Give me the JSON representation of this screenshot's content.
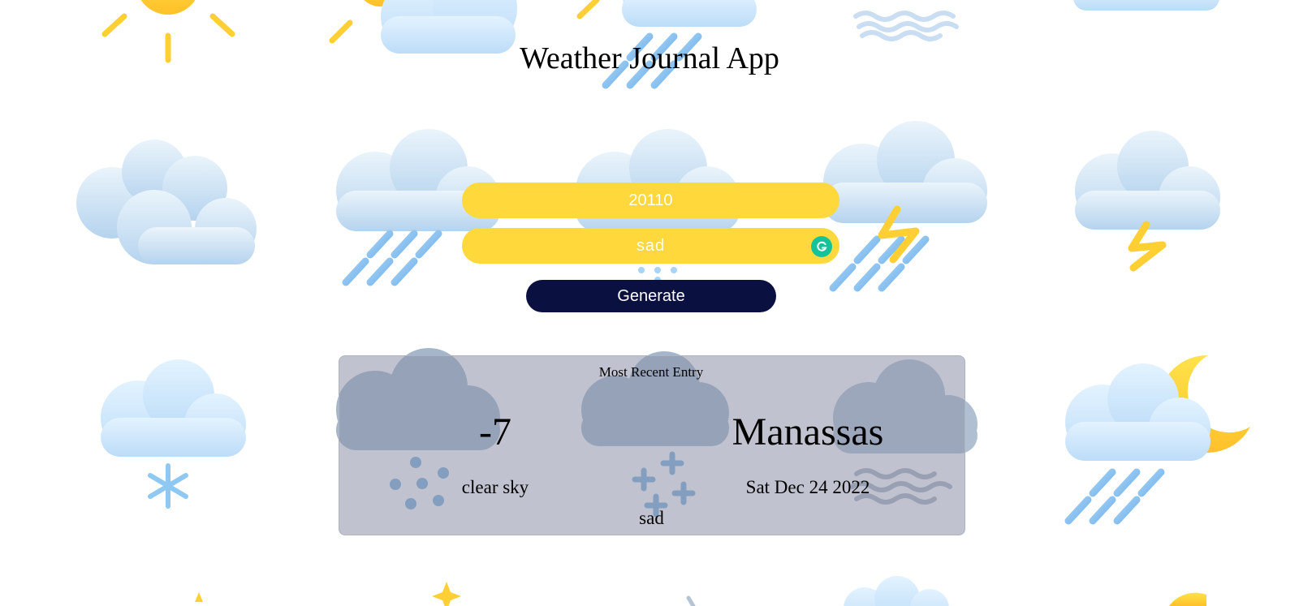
{
  "header": {
    "title": "Weather Journal App"
  },
  "form": {
    "zip_value": "20110",
    "feelings_value": "sad",
    "generate_label": "Generate"
  },
  "entry": {
    "heading": "Most Recent Entry",
    "temp": "-7",
    "city": "Manassas",
    "description": "clear sky",
    "date": "Sat Dec 24 2022",
    "feelings": "sad"
  },
  "colors": {
    "input_bg": "#ffd93b",
    "button_bg": "#0a1040",
    "entry_bg": "#bfc2cc",
    "grammarly": "#15c39a"
  },
  "icons": [
    "sun-icon",
    "cloud-icon",
    "rain-icon",
    "thunder-icon",
    "snow-icon",
    "fog-icon",
    "moon-icon",
    "sparkle-icon",
    "grammarly-icon"
  ]
}
